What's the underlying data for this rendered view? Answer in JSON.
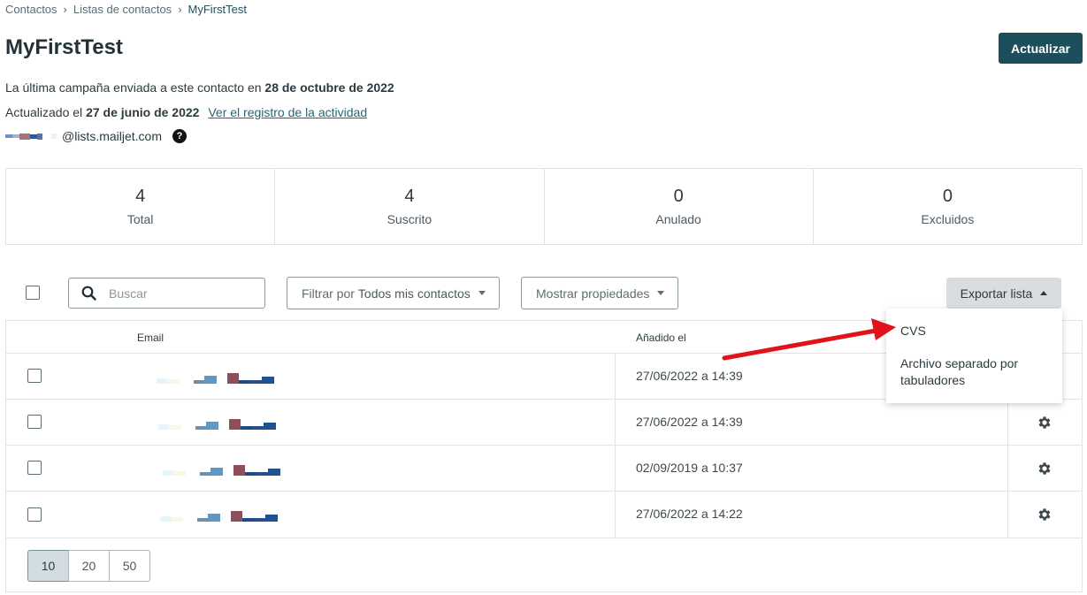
{
  "breadcrumb": {
    "items": [
      "Contactos",
      "Listas de contactos",
      "MyFirstTest"
    ]
  },
  "page": {
    "title": "MyFirstTest"
  },
  "header": {
    "update_label": "Actualizar"
  },
  "info": {
    "last_campaign_prefix": "La última campaña enviada a este contacto en",
    "last_campaign_date": "28 de octubre de 2022",
    "updated_prefix": "Actualizado el",
    "updated_date": "27 de junio de 2022",
    "activity_link": "Ver el registro de la actividad",
    "list_email_domain": "@lists.mailjet.com",
    "help_symbol": "?"
  },
  "stats": [
    {
      "value": "4",
      "label": "Total"
    },
    {
      "value": "4",
      "label": "Suscrito"
    },
    {
      "value": "0",
      "label": "Anulado"
    },
    {
      "value": "0",
      "label": "Excluidos"
    }
  ],
  "toolbar": {
    "search_placeholder": "Buscar",
    "filter_prefix": "Filtrar por",
    "filter_value": "Todos mis contactos",
    "show_properties": "Mostrar propiedades",
    "export_label": "Exportar lista"
  },
  "export_menu": {
    "items": [
      "CVS",
      "Archivo separado por tabuladores"
    ]
  },
  "table": {
    "columns": [
      "Email",
      "Añadido el"
    ],
    "rows": [
      {
        "added": "27/06/2022 a 14:39"
      },
      {
        "added": "27/06/2022 a 14:39"
      },
      {
        "added": "02/09/2019 a 10:37"
      },
      {
        "added": "27/06/2022 a 14:22"
      }
    ]
  },
  "pagination": {
    "sizes": [
      "10",
      "20",
      "50"
    ],
    "active": "10"
  },
  "colors": {
    "primary": "#1c4f5b",
    "annotation_arrow": "#e0131b"
  },
  "icons": [
    "chevron-right-icon",
    "help-icon",
    "search-icon",
    "caret-down-icon",
    "caret-up-icon",
    "gear-icon",
    "annotation-arrow"
  ]
}
